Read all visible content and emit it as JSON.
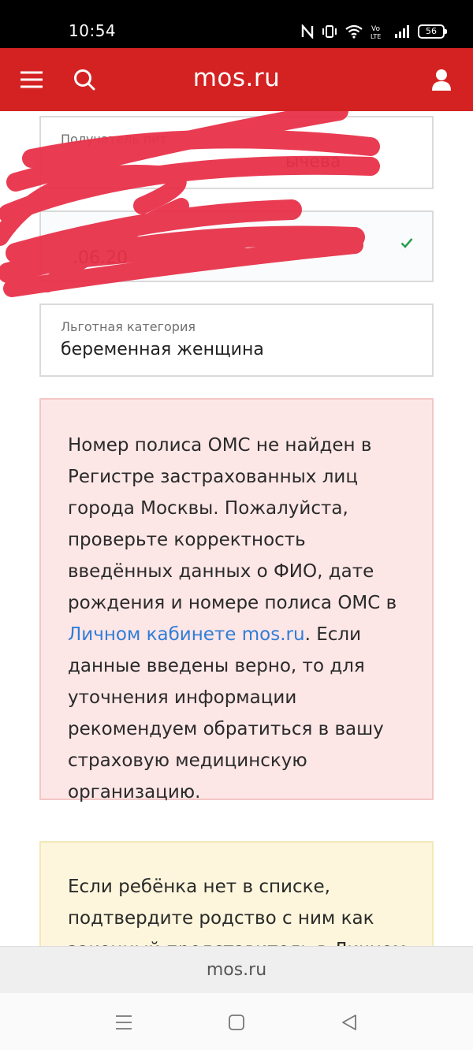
{
  "status_bar": {
    "time": "10:54",
    "battery": "56"
  },
  "header": {
    "title": "mos.ru",
    "menu_icon": "hamburger-menu-icon",
    "search_icon": "search-icon",
    "user_icon": "user-icon",
    "background_color": "#d42222"
  },
  "form": {
    "recipient": {
      "label": "Получатель пит",
      "value": "ычева"
    },
    "date_field": {
      "value": ".06.20"
    },
    "category": {
      "label": "Льготная категория",
      "value": "беременная женщина"
    }
  },
  "error_message": {
    "text_before_link": "Номер полиса ОМС не найден в Регистре застрахованных лиц города Москвы. Пожалуйста, проверьте корректность введённых данных о ФИО, дате рождения и номере полиса ОМС в ",
    "link_text": "Личном кабинете mos.ru",
    "text_after_link": ". Если данные введены верно, то для уточнения информации рекомендуем обратиться в вашу страховую медицинскую организацию."
  },
  "notice": {
    "text": "Если ребёнка нет в списке, подтвердите родство с ним как законный представитель в Личном"
  },
  "browser": {
    "url": "mos.ru"
  }
}
